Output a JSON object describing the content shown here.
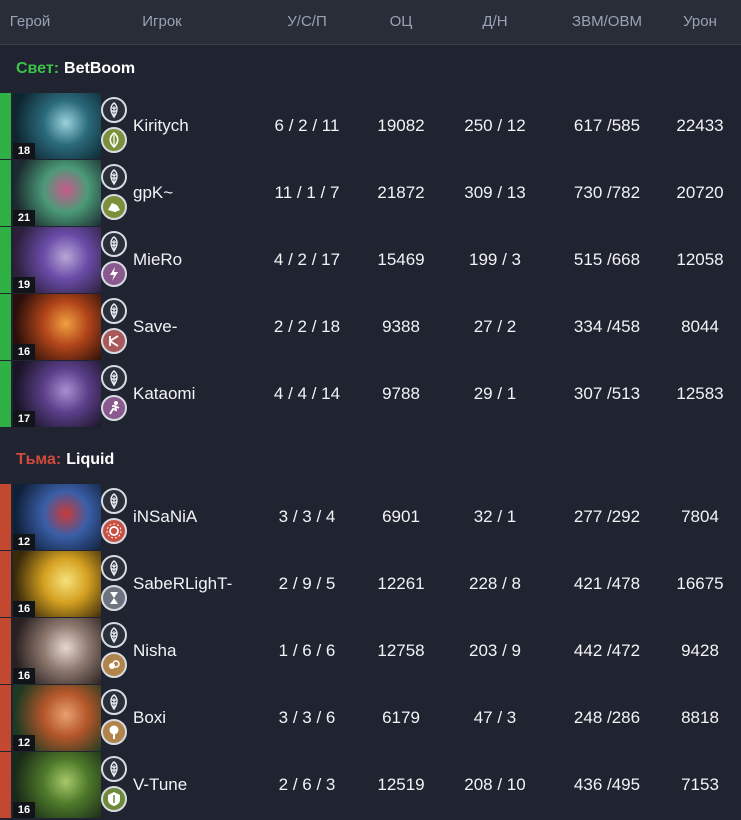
{
  "columns": {
    "hero": "Герой",
    "player": "Игрок",
    "kda": "У/С/П",
    "networth": "ОЦ",
    "lh_dn": "Д/Н",
    "gpm_xpm": "ЗВМ/ОВМ",
    "damage": "Урон"
  },
  "teams": [
    {
      "side": "Свет:",
      "name": "BetBoom",
      "side_color": "#3ec24a",
      "bar_color": "#2fb044",
      "players": [
        {
          "level": "18",
          "player": "Kiritych",
          "kda": "6 / 2 / 11",
          "networth": "19082",
          "lh_dn": "250 / 12",
          "gpm_xpm": "617 /585",
          "damage": "22433",
          "role_icon": "leaf-icon",
          "role_color": "#7c8f3a",
          "portrait": [
            "#0d2530",
            "#2b6b7c",
            "#9ad2dc"
          ]
        },
        {
          "level": "21",
          "player": "gpK~",
          "kda": "11 / 1 / 7",
          "networth": "21872",
          "lh_dn": "309 / 13",
          "gpm_xpm": "730 /782",
          "damage": "20720",
          "role_icon": "rock-icon",
          "role_color": "#7c8f3a",
          "portrait": [
            "#1a2a2e",
            "#4b9a78",
            "#c85a8c"
          ]
        },
        {
          "level": "19",
          "player": "MieRo",
          "kda": "4 / 2 / 17",
          "networth": "15469",
          "lh_dn": "199 / 3",
          "gpm_xpm": "515 /668",
          "damage": "12058",
          "role_icon": "bolt-icon",
          "role_color": "#8a5a8e",
          "portrait": [
            "#2b1f3a",
            "#6a4ca8",
            "#b9a7d6"
          ]
        },
        {
          "level": "16",
          "player": "Save-",
          "kda": "2 / 2 / 18",
          "networth": "9388",
          "lh_dn": "27 / 2",
          "gpm_xpm": "334 /458",
          "damage": "8044",
          "role_icon": "shield-break-icon",
          "role_color": "#a85a5a",
          "portrait": [
            "#2a0f0a",
            "#b2451a",
            "#f0a040"
          ]
        },
        {
          "level": "17",
          "player": "Kataomi",
          "kda": "4 / 4 / 14",
          "networth": "9788",
          "lh_dn": "29 / 1",
          "gpm_xpm": "307 /513",
          "damage": "12583",
          "role_icon": "runner-icon",
          "role_color": "#8a5a8e",
          "portrait": [
            "#1a1426",
            "#5b3f8a",
            "#a88fd0"
          ]
        }
      ]
    },
    {
      "side": "Тьма:",
      "name": "Liquid",
      "side_color": "#d24a3a",
      "bar_color": "#c2492f",
      "players": [
        {
          "level": "12",
          "player": "iNSaNiA",
          "kda": "3 / 3 / 4",
          "networth": "6901",
          "lh_dn": "32 / 1",
          "gpm_xpm": "277 /292",
          "damage": "7804",
          "role_icon": "sun-icon",
          "role_color": "#c85040",
          "portrait": [
            "#10203a",
            "#3a5fa8",
            "#c83a3a"
          ]
        },
        {
          "level": "16",
          "player": "SabeRLighT-",
          "kda": "2 / 9 / 5",
          "networth": "12261",
          "lh_dn": "228 / 8",
          "gpm_xpm": "421 /478",
          "damage": "16675",
          "role_icon": "hourglass-icon",
          "role_color": "#6d7480",
          "portrait": [
            "#3a2a0a",
            "#d4a021",
            "#f6e27a"
          ]
        },
        {
          "level": "16",
          "player": "Nisha",
          "kda": "1 / 6 / 6",
          "networth": "12758",
          "lh_dn": "203 / 9",
          "gpm_xpm": "442 /472",
          "damage": "9428",
          "role_icon": "coins-icon",
          "role_color": "#b0844a",
          "portrait": [
            "#2a2020",
            "#8f7a70",
            "#e6d8cf"
          ]
        },
        {
          "level": "12",
          "player": "Boxi",
          "kda": "3 / 3 / 6",
          "networth": "6179",
          "lh_dn": "47 / 3",
          "gpm_xpm": "248 /286",
          "damage": "8818",
          "role_icon": "tree-icon",
          "role_color": "#b0844a",
          "portrait": [
            "#1e3a22",
            "#b4562a",
            "#e8a070"
          ]
        },
        {
          "level": "16",
          "player": "V-Tune",
          "kda": "2 / 6 / 3",
          "networth": "12519",
          "lh_dn": "208 / 10",
          "gpm_xpm": "436 /495",
          "damage": "7153",
          "role_icon": "shield-icon",
          "role_color": "#6c8a3a",
          "portrait": [
            "#1a2a18",
            "#4e7a2a",
            "#a8c86a"
          ]
        }
      ]
    }
  ]
}
